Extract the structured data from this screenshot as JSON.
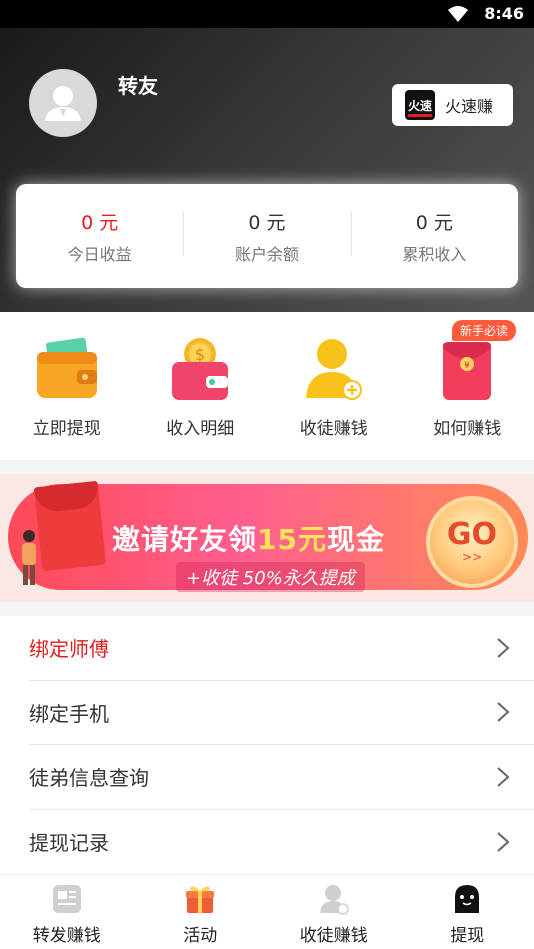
{
  "status_bar": {
    "time": "8:46"
  },
  "header": {
    "username": "转友",
    "partner": {
      "logo_text": "火速",
      "name": "火速赚"
    }
  },
  "earnings": [
    {
      "value": "0 元",
      "label": "今日收益",
      "color": "#e02020"
    },
    {
      "value": "0 元",
      "label": "账户余额",
      "color": "#333333"
    },
    {
      "value": "0 元",
      "label": "累积收入",
      "color": "#333333"
    }
  ],
  "quick_actions": [
    {
      "label": "立即提现",
      "icon": "wallet-icon"
    },
    {
      "label": "收入明细",
      "icon": "coin-wallet-icon"
    },
    {
      "label": "收徒赚钱",
      "icon": "add-user-icon"
    },
    {
      "label": "如何赚钱",
      "icon": "red-envelope-icon",
      "tag": "新手必读"
    }
  ],
  "banner": {
    "title_prefix": "邀请好友领",
    "title_highlight": "15元",
    "title_suffix": "现金",
    "subtitle": "+收徒 50%永久提成",
    "go_label": "GO",
    "go_arrows": ">>"
  },
  "menu": [
    {
      "label": "绑定师傅",
      "color": "#e02020"
    },
    {
      "label": "绑定手机",
      "color": "#333333"
    },
    {
      "label": "徒弟信息查询",
      "color": "#333333"
    },
    {
      "label": "提现记录",
      "color": "#333333"
    }
  ],
  "tabs": [
    {
      "label": "转发赚钱",
      "icon": "news-icon"
    },
    {
      "label": "活动",
      "icon": "gift-icon"
    },
    {
      "label": "收徒赚钱",
      "icon": "user-icon"
    },
    {
      "label": "提现",
      "icon": "ghost-icon"
    }
  ],
  "colors": {
    "accent_red": "#e02020",
    "header_dark": "#1a1a1a"
  }
}
